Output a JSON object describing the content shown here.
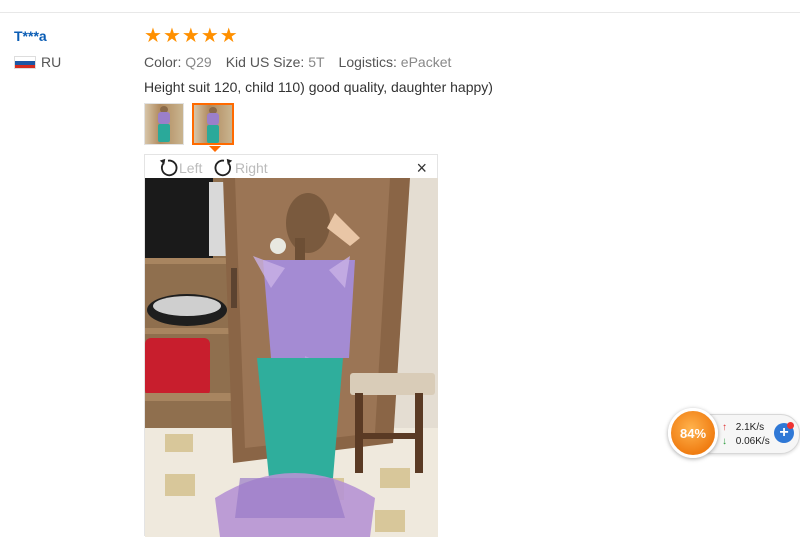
{
  "reviewer": {
    "name": "T***a",
    "country_code": "RU"
  },
  "review": {
    "stars": 5,
    "star_glyph": "★",
    "color_label": "Color:",
    "color_value": "Q29",
    "size_label": "Kid US Size:",
    "size_value": "5T",
    "logistics_label": "Logistics:",
    "logistics_value": "ePacket",
    "text": "Height suit 120, child 110) good quality, daughter happy)"
  },
  "viewer": {
    "rotate_left_label": "Left",
    "rotate_right_label": "Right",
    "close_glyph": "×"
  },
  "speed_widget": {
    "percent": "84%",
    "upload": "2.1K/s",
    "download": "0.06K/s",
    "up_glyph": "↑",
    "down_glyph": "↓",
    "plus_glyph": "+"
  },
  "colors": {
    "accent_orange": "#ff6a00",
    "star_orange": "#ff9000",
    "link_blue": "#0b5db5"
  }
}
